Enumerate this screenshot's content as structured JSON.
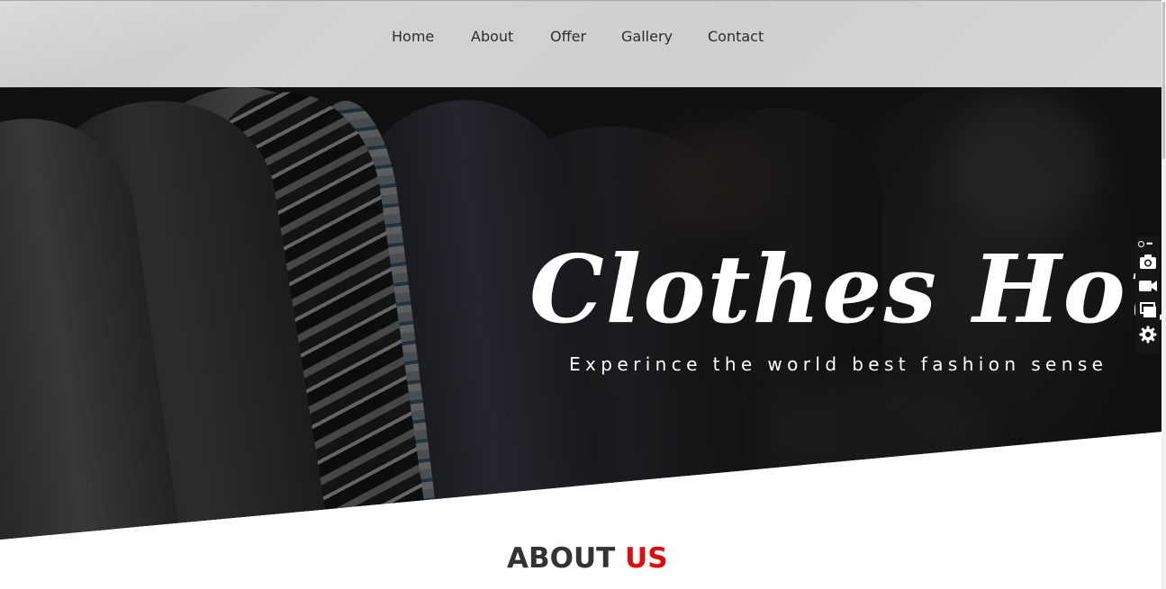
{
  "nav": {
    "items": [
      {
        "label": "Home"
      },
      {
        "label": "About"
      },
      {
        "label": "Offer"
      },
      {
        "label": "Gallery"
      },
      {
        "label": "Contact"
      }
    ]
  },
  "hero": {
    "title": "Clothes House",
    "subtitle": "Experince the world best fashion sense"
  },
  "about": {
    "heading_main": "ABOUT",
    "heading_accent": "US"
  },
  "toolbar": {
    "icons": [
      "pin-icon",
      "more-icon",
      "camera-icon",
      "video-camera-icon",
      "windows-icon",
      "gear-icon"
    ]
  },
  "colors": {
    "accent": "#e10d0d",
    "nav_bg": "#d0d0d0",
    "nav_text": "#2d2d2d",
    "hero_text": "#ffffff",
    "heading_text": "#333333"
  }
}
